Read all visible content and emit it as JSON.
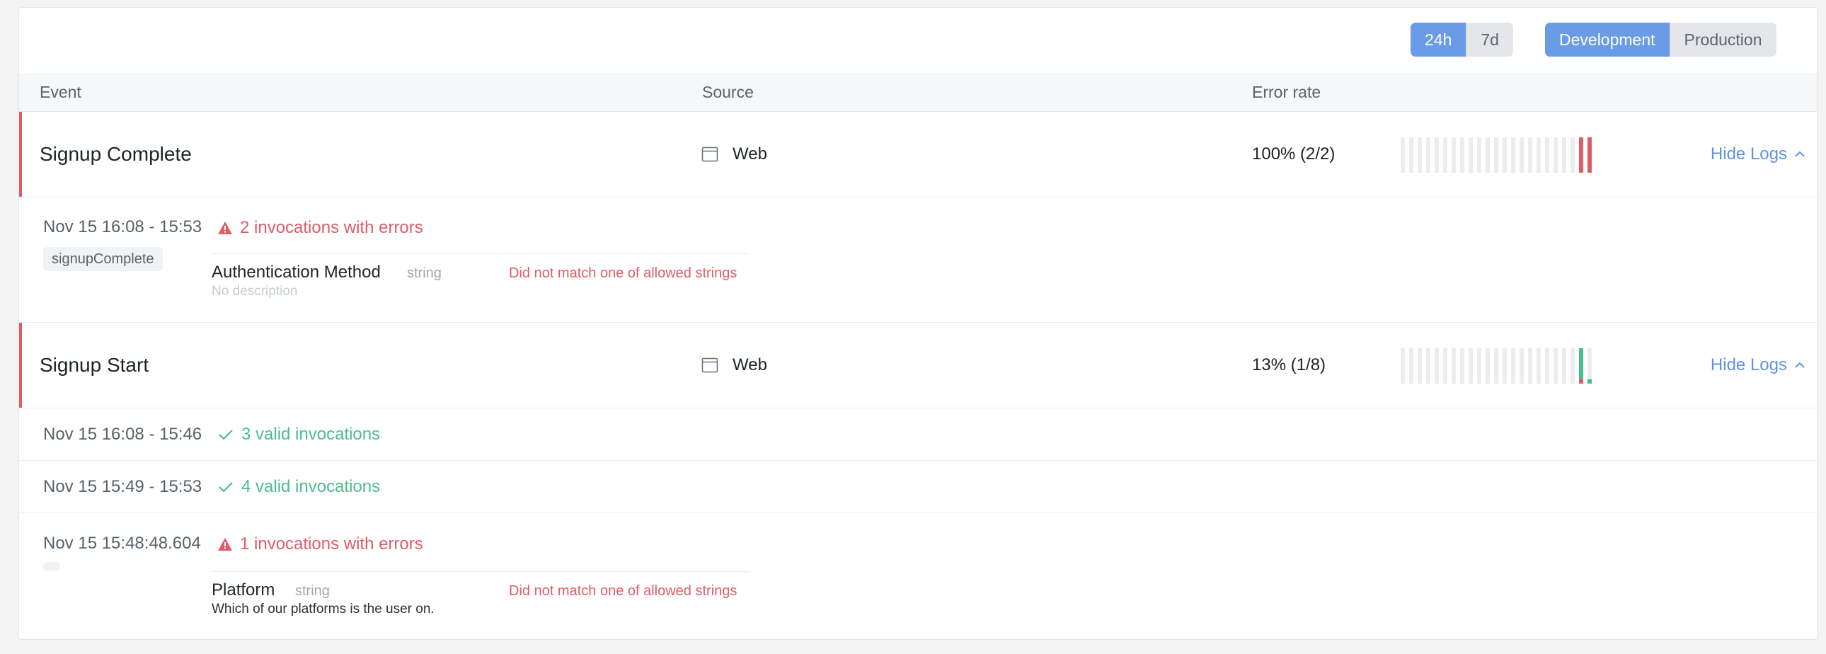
{
  "toolbar": {
    "time_filters": [
      "24h",
      "7d"
    ],
    "active_time": "24h",
    "env_filters": [
      "Development",
      "Production"
    ],
    "active_env": "Development"
  },
  "table": {
    "columns": {
      "event": "Event",
      "source": "Source",
      "error_rate": "Error rate"
    }
  },
  "events": [
    {
      "name": "Signup Complete",
      "source": "Web",
      "source_icon": "browser-window-icon",
      "error_rate": "100% (2/2)",
      "toggle_label": "Hide Logs",
      "sparkline": {
        "bars": 23,
        "valid": [
          0,
          0,
          0,
          0,
          0,
          0,
          0,
          0,
          0,
          0,
          0,
          0,
          0,
          0,
          0,
          0,
          0,
          0,
          0,
          0,
          0,
          0,
          0
        ],
        "errors": [
          0,
          0,
          0,
          0,
          0,
          0,
          0,
          0,
          0,
          0,
          0,
          0,
          0,
          0,
          0,
          0,
          0,
          0,
          0,
          0,
          0,
          1,
          1
        ]
      },
      "logs": [
        {
          "time": "Nov 15 16:08 - 15:53",
          "status": "2 invocations with errors",
          "status_type": "error",
          "tag": "signupComplete",
          "property": {
            "name": "Authentication Method",
            "type": "string",
            "error": "Did not match one of allowed strings",
            "description": "No description"
          }
        }
      ]
    },
    {
      "name": "Signup Start",
      "source": "Web",
      "source_icon": "browser-window-icon",
      "error_rate": "13% (1/8)",
      "toggle_label": "Hide Logs",
      "sparkline": {
        "bars": 23,
        "valid": [
          0,
          0,
          0,
          0,
          0,
          0,
          0,
          0,
          0,
          0,
          0,
          0,
          0,
          0,
          0,
          0,
          0,
          0,
          0,
          0,
          0,
          7,
          1
        ],
        "errors": [
          0,
          0,
          0,
          0,
          0,
          0,
          0,
          0,
          0,
          0,
          0,
          0,
          0,
          0,
          0,
          0,
          0,
          0,
          0,
          0,
          0,
          1,
          0
        ]
      },
      "logs": [
        {
          "time": "Nov 15 16:08 - 15:46",
          "status": "3 valid invocations",
          "status_type": "valid"
        },
        {
          "time": "Nov 15 15:49 - 15:53",
          "status": "4 valid invocations",
          "status_type": "valid"
        },
        {
          "time": "Nov 15 15:48:48.604",
          "status": "1 invocations with errors",
          "status_type": "error",
          "tag": "",
          "property": {
            "name": "Platform",
            "type": "string",
            "error": "Did not match one of allowed strings",
            "description": "Which of our platforms is the user on."
          }
        }
      ]
    }
  ],
  "colors": {
    "accent": "#6a9be6",
    "error": "#e05c64",
    "valid": "#49bd8e",
    "link": "#5d92e3"
  }
}
